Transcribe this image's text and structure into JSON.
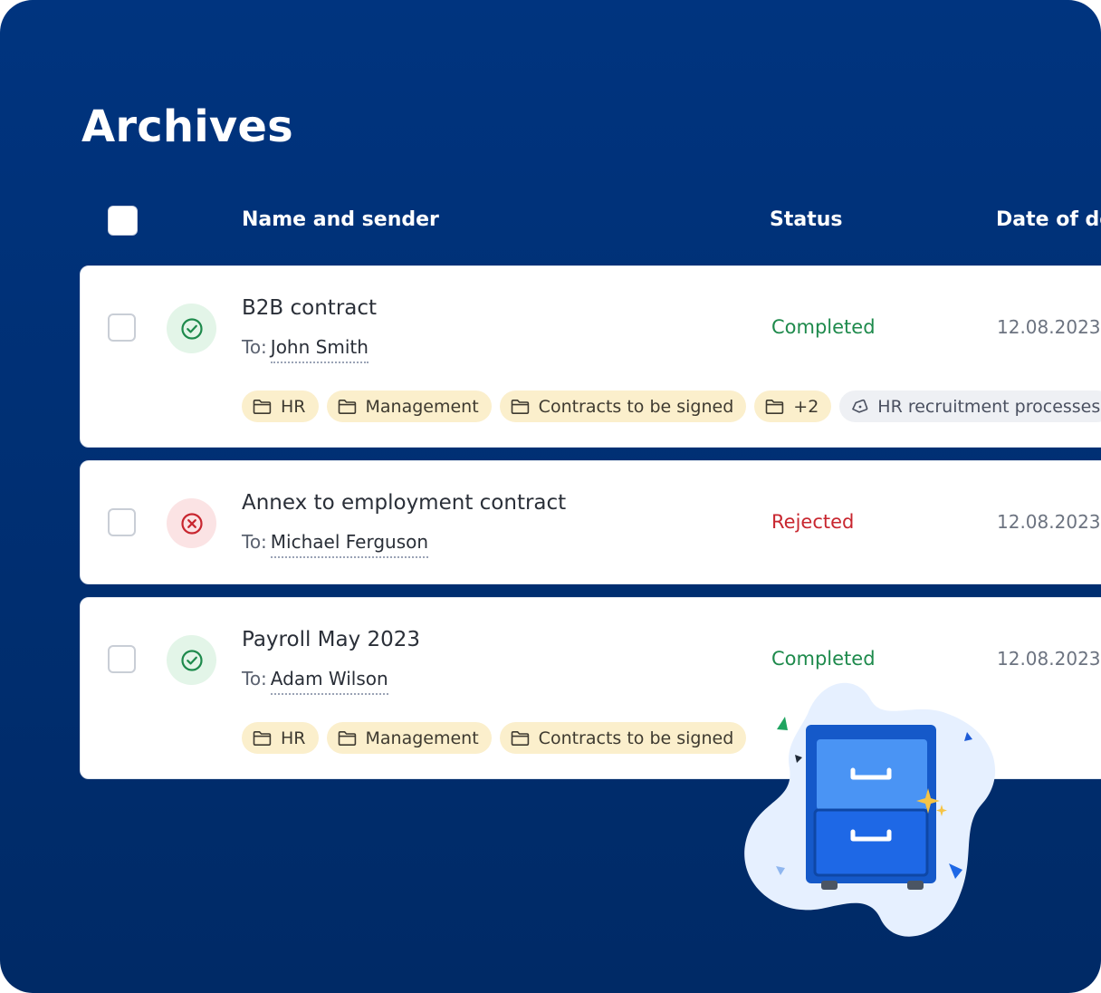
{
  "page": {
    "title": "Archives"
  },
  "table": {
    "columns": [
      "Name and sender",
      "Status",
      "Date of de"
    ],
    "rows": [
      {
        "name": "B2B contract",
        "to_prefix": "To:",
        "recipient": "John Smith",
        "status": "Completed",
        "date": "12.08.2023",
        "tags": [
          "HR",
          "Management",
          "Contracts to be signed",
          "+2"
        ],
        "label_tag": "HR recruitment processes"
      },
      {
        "name": "Annex to employment contract",
        "to_prefix": "To:",
        "recipient": "Michael Ferguson",
        "status": "Rejected",
        "date": "12.08.2023"
      },
      {
        "name": "Payroll May 2023",
        "to_prefix": "To:",
        "recipient": "Adam Wilson",
        "status": "Completed",
        "date": "12.08.2023",
        "tags": [
          "HR",
          "Management",
          "Contracts to be signed"
        ]
      }
    ]
  },
  "icons": {
    "completed": "check-circle-icon",
    "rejected": "x-circle-icon",
    "folder": "folder-icon",
    "label": "tag-icon",
    "illustration": "filing-cabinet-icon"
  },
  "colors": {
    "background": "#00347f",
    "completed": "#1e8a4c",
    "rejected": "#c8262f",
    "folder_tag_bg": "#fbefcc",
    "label_tag_bg": "#eef0f4"
  }
}
